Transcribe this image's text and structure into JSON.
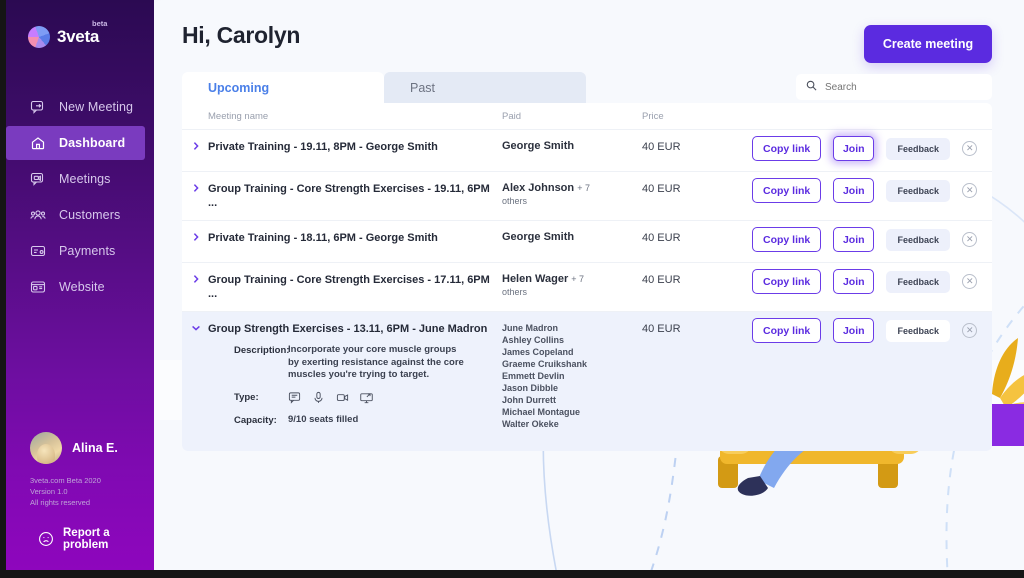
{
  "brand": {
    "name": "3veta",
    "badge": "beta",
    "logo_icon": "pie-chart-logo"
  },
  "sidebar": {
    "items": [
      {
        "label": "New Meeting",
        "icon": "new-meeting-icon",
        "active": false
      },
      {
        "label": "Dashboard",
        "icon": "home-icon",
        "active": true
      },
      {
        "label": "Meetings",
        "icon": "video-chat-icon",
        "active": false
      },
      {
        "label": "Customers",
        "icon": "users-icon",
        "active": false
      },
      {
        "label": "Payments",
        "icon": "card-icon",
        "active": false
      },
      {
        "label": "Website",
        "icon": "browser-icon",
        "active": false
      }
    ],
    "profile": {
      "name": "Alina E.",
      "avatar_icon": "user-avatar"
    },
    "legal": [
      "3veta.com Beta 2020",
      "Version 1.0",
      "All rights reserved"
    ],
    "report": {
      "label": "Report a problem",
      "icon": "sad-face-icon"
    }
  },
  "header": {
    "title": "Hi, Carolyn",
    "create_button": "Create meeting"
  },
  "tabs": [
    {
      "label": "Upcoming",
      "active": true
    },
    {
      "label": "Past",
      "active": false
    }
  ],
  "search": {
    "placeholder": "Search",
    "value": "",
    "icon": "search-icon"
  },
  "table": {
    "columns": [
      "Meeting name",
      "Paid",
      "Price",
      ""
    ],
    "rows": [
      {
        "expanded": false,
        "name": "Private Training - 19.11, 8PM - George Smith",
        "paid_name": "George Smith",
        "paid_extra": "",
        "paid_others": "",
        "price": "40 EUR",
        "copy_label": "Copy link",
        "join_label": "Join",
        "join_focused": true,
        "feedback_label": "Feedback"
      },
      {
        "expanded": false,
        "name": "Group Training - Core Strength Exercises - 19.11, 6PM ...",
        "paid_name": "Alex Johnson",
        "paid_extra": "+ 7",
        "paid_others": "others",
        "price": "40 EUR",
        "copy_label": "Copy link",
        "join_label": "Join",
        "join_focused": false,
        "feedback_label": "Feedback"
      },
      {
        "expanded": false,
        "name": "Private Training - 18.11, 6PM - George Smith",
        "paid_name": "George Smith",
        "paid_extra": "",
        "paid_others": "",
        "price": "40 EUR",
        "copy_label": "Copy link",
        "join_label": "Join",
        "join_focused": false,
        "feedback_label": "Feedback"
      },
      {
        "expanded": false,
        "name": "Group Training - Core Strength Exercises - 17.11, 6PM ...",
        "paid_name": "Helen Wager",
        "paid_extra": "+ 7",
        "paid_others": "others",
        "price": "40 EUR",
        "copy_label": "Copy link",
        "join_label": "Join",
        "join_focused": false,
        "feedback_label": "Feedback"
      },
      {
        "expanded": true,
        "name": "Group Strength Exercises - 13.11, 6PM - June Madron",
        "price": "40 EUR",
        "copy_label": "Copy link",
        "join_label": "Join",
        "join_focused": false,
        "feedback_label": "Feedback",
        "detail": {
          "description_label": "Description:",
          "description": "Incorporate your core muscle groups by exerting resistance against the core muscles you're trying to target.",
          "type_label": "Type:",
          "type_icons": [
            "chat-icon",
            "microphone-icon",
            "video-camera-icon",
            "screen-share-icon"
          ],
          "capacity_label": "Capacity:",
          "capacity_value_bold": "9/10",
          "capacity_value_rest": "seats filled"
        },
        "attendees": [
          "June Madron",
          "Ashley Collins",
          "James Copeland",
          "Graeme Cruikshank",
          "Emmett Devlin",
          "Jason Dibble",
          "John Durrett",
          "Michael Montague",
          "Walter Okeke"
        ]
      }
    ]
  },
  "illustration": {
    "description": "woman with headphones sitting on yellow couch using a laptop, potted plant, play-button badge, dashed curves",
    "colors": {
      "couch": "#f5c03a",
      "couch_dark": "#e0a91f",
      "plant_pot": "#8a2be2",
      "shirt": "#c84fe0",
      "jeans": "#7ea6f0",
      "hair": "#2d3159",
      "play_badge": "#f7d06a",
      "play_arrow": "#5b2be0"
    }
  },
  "theme": {
    "accent": "#5b2be0",
    "accent_outline": "#6b3ce8",
    "tab_active_text": "#4a7fe8",
    "sidebar_top": "#2b0a52",
    "sidebar_bottom": "#8e06bd",
    "sidebar_active": "#7a3bbf",
    "panel_bg": "#f7f9fd",
    "row_expanded_bg": "#eef2fc"
  }
}
